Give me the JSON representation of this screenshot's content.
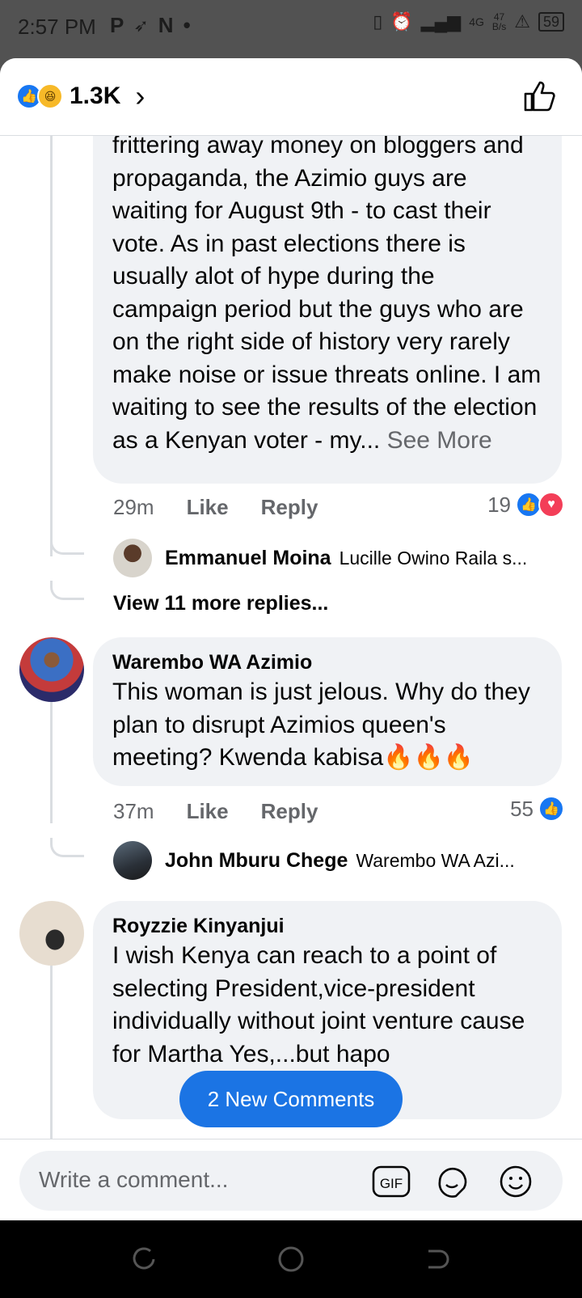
{
  "status_bar": {
    "time": "2:57 PM",
    "apps": [
      "P",
      "N",
      "•"
    ],
    "network": "4G",
    "speed_value": "47",
    "speed_unit": "B/s",
    "battery": "59"
  },
  "header": {
    "reaction_count": "1.3K",
    "reaction_icons": [
      "like-icon",
      "haha-icon"
    ]
  },
  "comments": [
    {
      "text_tail": "frittering away money on bloggers and propaganda, the Azimio guys are waiting for August 9th - to cast their vote.  As in past elections there is usually alot of hype during the campaign period but the guys who are on the right side of history very rarely make noise or issue threats online.  I am waiting to see the results of the election as a Kenyan voter - my...",
      "see_more": "See More",
      "time": "29m",
      "like": "Like",
      "reply": "Reply",
      "reaction_count": "19",
      "reply_preview": {
        "name": "Emmanuel Moina",
        "snippet": "Lucille Owino Raila s..."
      },
      "view_more": "View 11 more replies..."
    },
    {
      "author": "Warembo WA Azimio",
      "text": "This woman is just jelous. Why do they plan to disrupt Azimios queen's meeting? Kwenda kabisa🔥🔥🔥",
      "time": "37m",
      "like": "Like",
      "reply": "Reply",
      "reaction_count": "55",
      "reply_preview": {
        "name": "John Mburu Chege",
        "snippet": "Warembo WA Azi..."
      }
    },
    {
      "author": "Royzzie Kinyanjui",
      "text": "I wish Kenya can reach to a point of selecting President,vice-president individually without joint venture cause for Martha Yes,...but hapo"
    }
  ],
  "new_comments_button": "2 New Comments",
  "composer": {
    "placeholder": "Write a comment...",
    "gif_label": "GIF"
  },
  "colors": {
    "accent": "#1877f2",
    "bubble": "#f0f2f5",
    "muted_text": "#65676b",
    "love": "#f33e58"
  }
}
